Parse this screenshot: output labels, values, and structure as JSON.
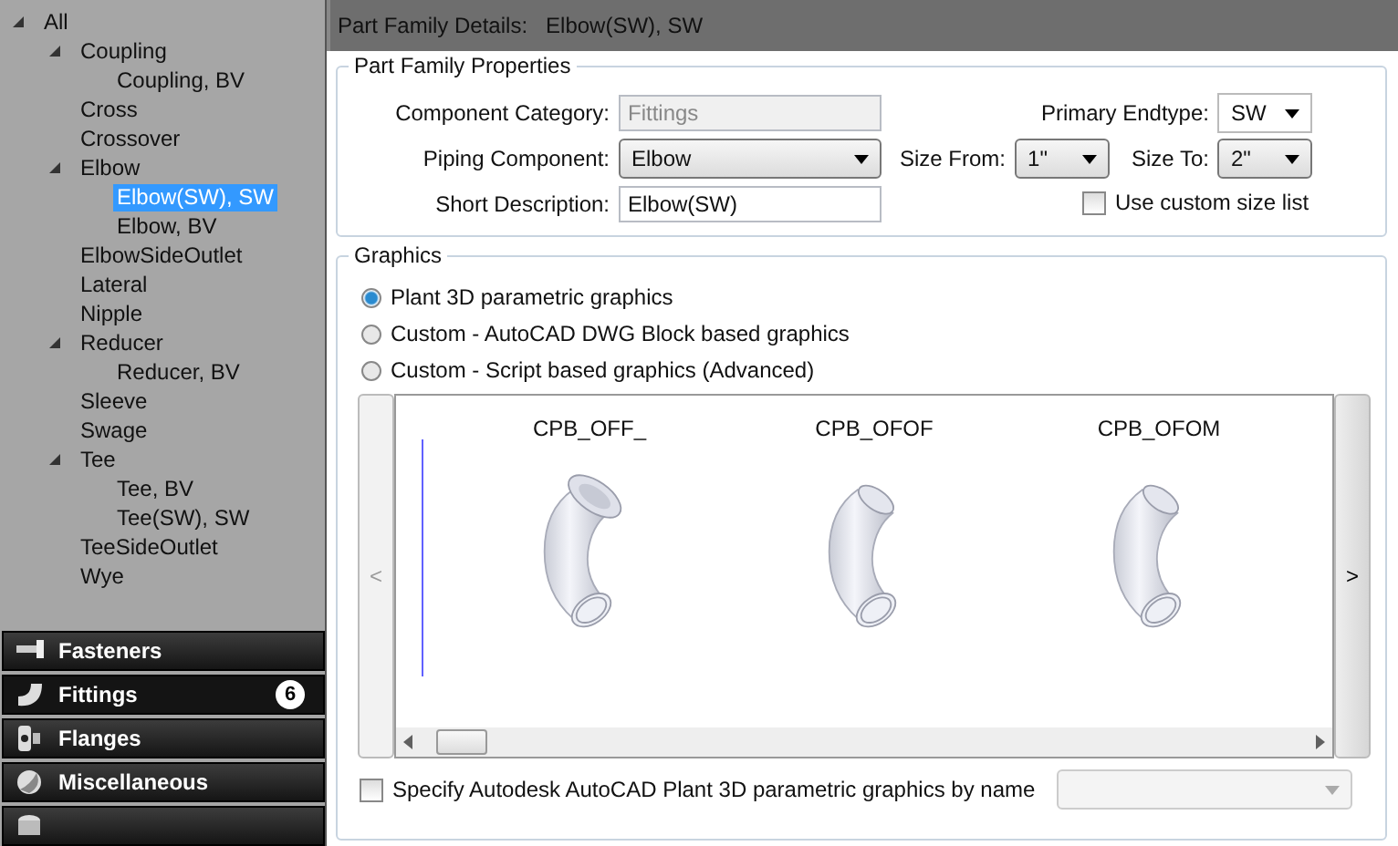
{
  "tree": [
    {
      "label": "All",
      "expanded": true,
      "selected": false,
      "children": [
        {
          "label": "Coupling",
          "expanded": true,
          "selected": false,
          "children": [
            {
              "label": "Coupling, BV",
              "selected": false
            }
          ]
        },
        {
          "label": "Cross",
          "selected": false
        },
        {
          "label": "Crossover",
          "selected": false
        },
        {
          "label": "Elbow",
          "expanded": true,
          "selected": false,
          "children": [
            {
              "label": "Elbow(SW), SW",
              "selected": true
            },
            {
              "label": "Elbow, BV",
              "selected": false
            }
          ]
        },
        {
          "label": "ElbowSideOutlet",
          "selected": false
        },
        {
          "label": "Lateral",
          "selected": false
        },
        {
          "label": "Nipple",
          "selected": false
        },
        {
          "label": "Reducer",
          "expanded": true,
          "selected": false,
          "children": [
            {
              "label": "Reducer, BV",
              "selected": false
            }
          ]
        },
        {
          "label": "Sleeve",
          "selected": false
        },
        {
          "label": "Swage",
          "selected": false
        },
        {
          "label": "Tee",
          "expanded": true,
          "selected": false,
          "children": [
            {
              "label": "Tee, BV",
              "selected": false
            },
            {
              "label": "Tee(SW), SW",
              "selected": false
            }
          ]
        },
        {
          "label": "TeeSideOutlet",
          "selected": false
        },
        {
          "label": "Wye",
          "selected": false
        }
      ]
    }
  ],
  "categories": [
    {
      "kind": "bolt",
      "label": "Fasteners",
      "selected": false
    },
    {
      "kind": "elbow",
      "label": "Fittings",
      "selected": true,
      "badge": "6"
    },
    {
      "kind": "flange",
      "label": "Flanges",
      "selected": false
    },
    {
      "kind": "sphere",
      "label": "Miscellaneous",
      "selected": false
    },
    {
      "kind": "cylinder",
      "selected": false
    }
  ],
  "header": {
    "title": "Part Family Details:",
    "value": "Elbow(SW), SW"
  },
  "properties": {
    "title": "Part Family Properties",
    "component_category": {
      "label": "Component Category:",
      "value": "Fittings",
      "disabled": true
    },
    "piping_component": {
      "label": "Piping Component:",
      "value": "Elbow"
    },
    "short_description": {
      "label": "Short Description:",
      "value": "Elbow(SW)"
    },
    "primary_endtype": {
      "label": "Primary Endtype:",
      "value": "SW"
    },
    "size_from": {
      "label": "Size From:",
      "value": "1\""
    },
    "size_to": {
      "label": "Size To:",
      "value": "2\""
    },
    "custom_size_list": {
      "label": "Use custom size list",
      "checked": false
    }
  },
  "graphics": {
    "title": "Graphics",
    "options": [
      {
        "label": "Plant 3D parametric graphics",
        "selected": true
      },
      {
        "label": "Custom - AutoCAD DWG Block based graphics",
        "selected": false
      },
      {
        "label": "Custom - Script based graphics (Advanced)",
        "selected": false
      }
    ],
    "prev": "<",
    "next": ">",
    "items": [
      {
        "label": "CPB_OFF_",
        "kind": "flanged"
      },
      {
        "label": "CPB_OFOF",
        "kind": "plain"
      },
      {
        "label": "CPB_OFOM",
        "kind": "plain"
      }
    ],
    "by_name": {
      "label": "Specify Autodesk AutoCAD Plant 3D parametric graphics by name",
      "checked": false
    }
  }
}
